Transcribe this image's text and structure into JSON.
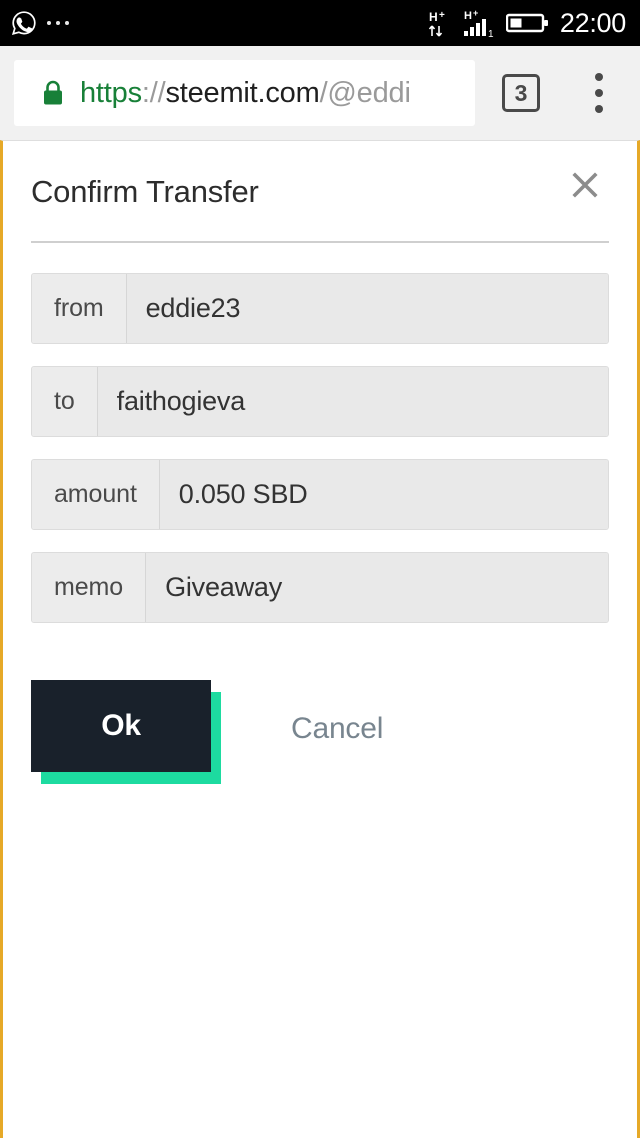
{
  "status_bar": {
    "notification_icons": [
      "whatsapp-icon",
      "more-notifications-dots"
    ],
    "network_label_1": "H+",
    "network_label_2": "H+",
    "signal_sim_label": "1",
    "battery_level_percent": 35,
    "clock": "22:00",
    "background_color": "#000000",
    "text_color": "#ffffff"
  },
  "browser": {
    "url": {
      "scheme": "https",
      "separator": "://",
      "host": "steemit.com",
      "path": "/@eddi",
      "truncated": true,
      "secure": true,
      "scheme_color": "#188038",
      "host_color": "#1f1f1f",
      "path_color": "#9a9a9a"
    },
    "tab_count": "3",
    "menu_label": "more-options",
    "chrome_background": "#f1f1f1"
  },
  "page": {
    "border_color": "#e6a928"
  },
  "dialog": {
    "title": "Confirm Transfer",
    "close_label": "×",
    "fields": [
      {
        "label": "from",
        "value": "eddie23"
      },
      {
        "label": "to",
        "value": "faithogieva"
      },
      {
        "label": "amount",
        "value": "0.050 SBD"
      },
      {
        "label": "memo",
        "value": "Giveaway"
      }
    ],
    "actions": {
      "confirm_label": "Ok",
      "cancel_label": "Cancel",
      "confirm_background": "#19212b",
      "confirm_accent": "#1ddba0",
      "cancel_color": "#78858f"
    }
  }
}
